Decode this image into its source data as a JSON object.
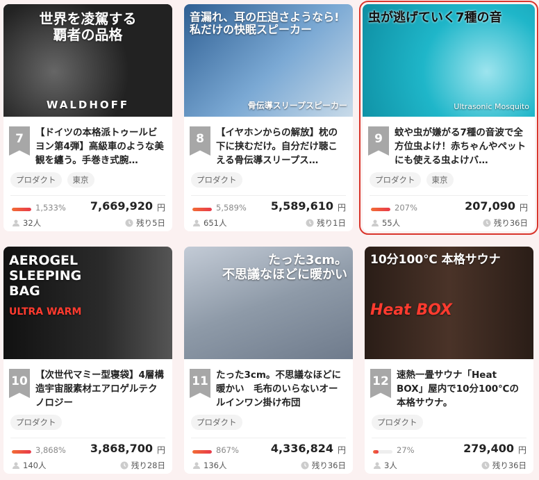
{
  "cards": [
    {
      "rank": "7",
      "title": "【ドイツの本格派トゥールビヨン第4弾】高級車のような美観を纏う。手巻き式腕…",
      "tags": [
        "プロダクト",
        "東京"
      ],
      "percent": "1,533%",
      "amount": "7,669,920",
      "currency": "円",
      "backers": "32人",
      "remaining": "残り5日",
      "thumb_caption_top": "世界を凌駕する\n覇者の品格",
      "thumb_caption_bottom": "WALDHOFF",
      "thumb_bg": "#2b2b2b",
      "highlighted": false
    },
    {
      "rank": "8",
      "title": "【イヤホンからの解放】枕の下に挟むだけ。自分だけ聴こえる骨伝導スリープス…",
      "tags": [
        "プロダクト"
      ],
      "percent": "5,589%",
      "amount": "5,589,610",
      "currency": "円",
      "backers": "651人",
      "remaining": "残り1日",
      "thumb_caption_top": "音漏れ、耳の圧迫さようなら!\n私だけの快眠スピーカー",
      "thumb_caption_bottom": "骨伝導スリープスピーカー",
      "thumb_bg": "#4a7fb0",
      "highlighted": false
    },
    {
      "rank": "9",
      "title": "蚊や虫が嫌がる7種の音波で全方位虫よけ！赤ちゃんやペットにも使える虫よけバ…",
      "tags": [
        "プロダクト",
        "東京"
      ],
      "percent": "207%",
      "amount": "207,090",
      "currency": "円",
      "backers": "55人",
      "remaining": "残り36日",
      "thumb_caption_top": "虫が逃げていく7種の音",
      "thumb_caption_bottom": "Ultrasonic Mosquito",
      "thumb_bg": "#1fb6c9",
      "highlighted": true
    },
    {
      "rank": "10",
      "title": "【次世代マミー型寝袋】4層構造宇宙服素材エアロゲルテクノロジー",
      "tags": [
        "プロダクト"
      ],
      "percent": "3,868%",
      "amount": "3,868,700",
      "currency": "円",
      "backers": "140人",
      "remaining": "残り28日",
      "thumb_caption_top": "AEROGEL\nSLEEPING\nBAG",
      "thumb_caption_bottom": "ULTRA WARM",
      "thumb_bg": "#1c1c1c",
      "highlighted": false
    },
    {
      "rank": "11",
      "title": "たった3cm。不思議なほどに暖かい　毛布のいらないオールインワン掛け布団",
      "tags": [
        "プロダクト"
      ],
      "percent": "867%",
      "amount": "4,336,824",
      "currency": "円",
      "backers": "136人",
      "remaining": "残り36日",
      "thumb_caption_top": "たった3cm。\n不思議なほどに暖かい",
      "thumb_caption_bottom": "",
      "thumb_bg": "#8e9aa8",
      "highlighted": false
    },
    {
      "rank": "12",
      "title": "速熱一畳サウナ「Heat BOX」屋内で10分100℃の本格サウナ。",
      "tags": [
        "プロダクト"
      ],
      "percent": "27%",
      "amount": "279,400",
      "currency": "円",
      "backers": "3人",
      "remaining": "残り36日",
      "thumb_caption_top": "10分100℃ 本格サウナ",
      "thumb_caption_bottom": "Heat BOX",
      "thumb_bg": "#3b2a22",
      "highlighted": false
    }
  ],
  "progress": [
    1,
    1,
    1,
    1,
    1,
    0.27
  ]
}
